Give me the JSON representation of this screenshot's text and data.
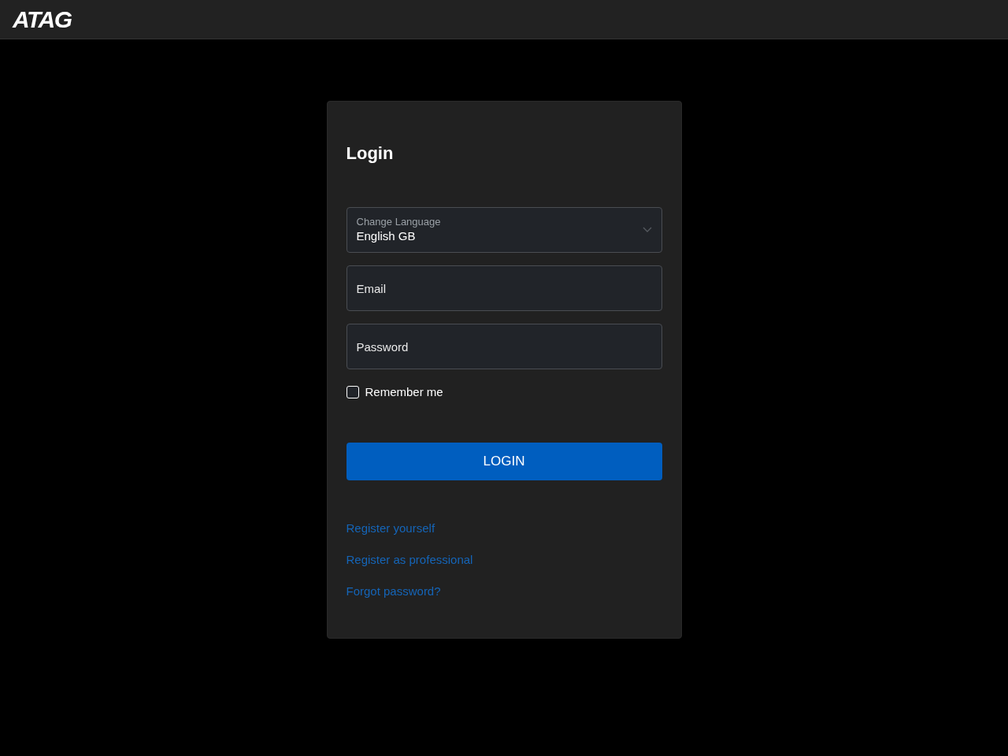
{
  "header": {
    "logo": "ATAG"
  },
  "login": {
    "title": "Login",
    "language": {
      "label": "Change Language",
      "value": "English GB"
    },
    "email": {
      "placeholder": "Email"
    },
    "password": {
      "placeholder": "Password"
    },
    "remember": {
      "label": "Remember me",
      "checked": false
    },
    "button": "LOGIN",
    "links": [
      "Register yourself",
      "Register as professional",
      "Forgot password?"
    ]
  }
}
